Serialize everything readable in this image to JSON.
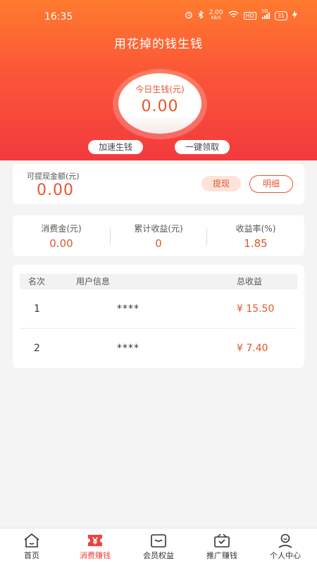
{
  "status_bar": {
    "time": "16:35",
    "speed_value": "2.00",
    "speed_unit": "KB/S",
    "hd": "HD",
    "signal": "5G",
    "battery": "31"
  },
  "header": {
    "title": "用花掉的钱生钱",
    "today_label": "今日生钱(元)",
    "today_value": "0.00",
    "speed_button": "加速生钱",
    "collect_button": "一键领取"
  },
  "withdraw": {
    "label": "可提现金额(元)",
    "value": "0.00",
    "withdraw_button": "提现",
    "detail_button": "明细"
  },
  "stats": [
    {
      "label": "消费金(元)",
      "value": "0.00"
    },
    {
      "label": "累计收益(元)",
      "value": "0"
    },
    {
      "label": "收益率(%)",
      "value": "1.85"
    }
  ],
  "ranking": {
    "headers": {
      "rank": "名次",
      "user": "用户信息",
      "total": "总收益"
    },
    "rows": [
      {
        "rank": "1",
        "user": "****",
        "earnings": "¥ 15.50"
      },
      {
        "rank": "2",
        "user": "****",
        "earnings": "¥ 7.40"
      }
    ]
  },
  "nav": {
    "items": [
      {
        "label": "首页",
        "icon": "home-icon"
      },
      {
        "label": "消费赚钱",
        "icon": "yen-ticket-icon",
        "active": true
      },
      {
        "label": "会员权益",
        "icon": "wallet-icon"
      },
      {
        "label": "推广赚钱",
        "icon": "gift-box-icon"
      },
      {
        "label": "个人中心",
        "icon": "person-icon"
      }
    ]
  },
  "colors": {
    "accent": "#e4572c",
    "header_top": "#ff7b2e",
    "header_bottom": "#f33a3e",
    "nav_active": "#f0413c"
  }
}
